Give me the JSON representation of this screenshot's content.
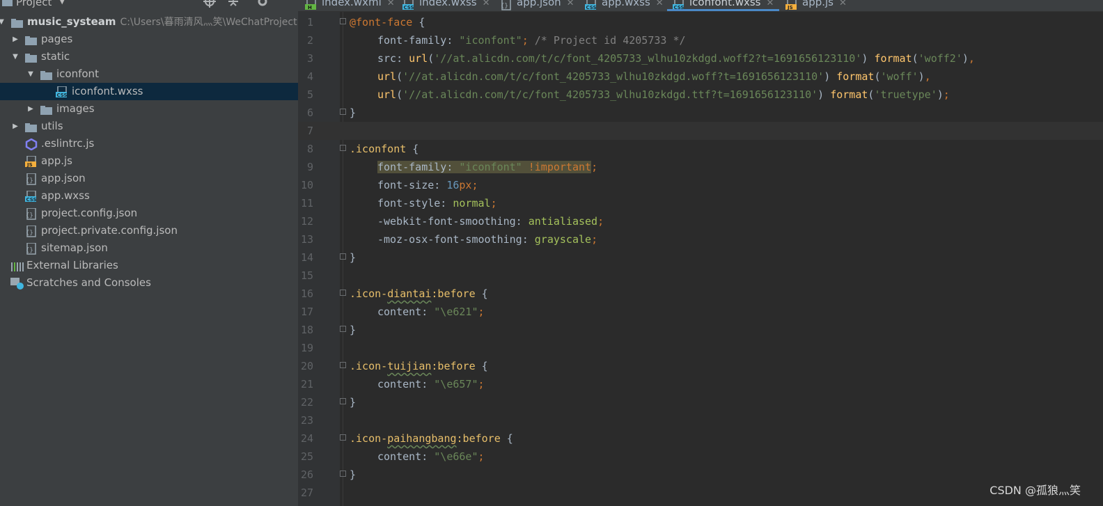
{
  "project_panel": {
    "title": "Project",
    "tree": [
      {
        "depth": 0,
        "arrow": "down",
        "icon": "folder",
        "label": "music_systeam",
        "path": "C:\\Users\\暮雨清风灬笑\\WeChatProject",
        "bold": true
      },
      {
        "depth": 1,
        "arrow": "right",
        "icon": "folder",
        "label": "pages"
      },
      {
        "depth": 1,
        "arrow": "down",
        "icon": "folder",
        "label": "static"
      },
      {
        "depth": 2,
        "arrow": "down",
        "icon": "folder",
        "label": "iconfont"
      },
      {
        "depth": 3,
        "arrow": "none",
        "icon": "css-file",
        "label": "iconfont.wxss",
        "selected": true
      },
      {
        "depth": 2,
        "arrow": "right",
        "icon": "folder",
        "label": "images"
      },
      {
        "depth": 1,
        "arrow": "right",
        "icon": "folder",
        "label": "utils"
      },
      {
        "depth": 1,
        "arrow": "none",
        "icon": "eslint",
        "label": ".eslintrc.js"
      },
      {
        "depth": 1,
        "arrow": "none",
        "icon": "js-file",
        "label": "app.js"
      },
      {
        "depth": 1,
        "arrow": "none",
        "icon": "json-file",
        "label": "app.json"
      },
      {
        "depth": 1,
        "arrow": "none",
        "icon": "css-file",
        "label": "app.wxss"
      },
      {
        "depth": 1,
        "arrow": "none",
        "icon": "json-file",
        "label": "project.config.json"
      },
      {
        "depth": 1,
        "arrow": "none",
        "icon": "json-file",
        "label": "project.private.config.json"
      },
      {
        "depth": 1,
        "arrow": "none",
        "icon": "json-file",
        "label": "sitemap.json"
      },
      {
        "depth": 0,
        "arrow": "none",
        "icon": "library",
        "label": "External Libraries"
      },
      {
        "depth": 0,
        "arrow": "none",
        "icon": "scratches",
        "label": "Scratches and Consoles"
      }
    ]
  },
  "tabs": [
    {
      "label": "index.wxml",
      "icon": "html-file",
      "active": false
    },
    {
      "label": "index.wxss",
      "icon": "css-file",
      "active": false
    },
    {
      "label": "app.json",
      "icon": "json-file",
      "active": false
    },
    {
      "label": "app.wxss",
      "icon": "css-file",
      "active": false
    },
    {
      "label": "iconfont.wxss",
      "icon": "css-file",
      "active": true
    },
    {
      "label": "app.js",
      "icon": "js-file",
      "active": false
    }
  ],
  "code_lines": [
    {
      "n": "1",
      "fold": true,
      "indent": false,
      "tokens": [
        [
          "kw",
          "@font-face"
        ],
        [
          "brace",
          " {"
        ]
      ]
    },
    {
      "n": "2",
      "indent": true,
      "tokens": [
        [
          "prop",
          "font-family: "
        ],
        [
          "str",
          "\"iconfont\""
        ],
        [
          "punc",
          ";"
        ],
        [
          "cmt",
          " /* Project id 4205733 */"
        ]
      ]
    },
    {
      "n": "3",
      "indent": true,
      "tokens": [
        [
          "prop",
          "src: "
        ],
        [
          "fn",
          "url"
        ],
        [
          "brace",
          "("
        ],
        [
          "str",
          "'//at.alicdn.com/t/c/font_4205733_wlhu10zkdgd.woff2?t=1691656123110'"
        ],
        [
          "brace",
          ") "
        ],
        [
          "fn",
          "format"
        ],
        [
          "brace",
          "("
        ],
        [
          "str",
          "'woff2'"
        ],
        [
          "brace",
          ")"
        ],
        [
          "punc",
          ","
        ]
      ]
    },
    {
      "n": "4",
      "indent": true,
      "tokens": [
        [
          "fn",
          "url"
        ],
        [
          "brace",
          "("
        ],
        [
          "str",
          "'//at.alicdn.com/t/c/font_4205733_wlhu10zkdgd.woff?t=1691656123110'"
        ],
        [
          "brace",
          ") "
        ],
        [
          "fn",
          "format"
        ],
        [
          "brace",
          "("
        ],
        [
          "str",
          "'woff'"
        ],
        [
          "brace",
          ")"
        ],
        [
          "punc",
          ","
        ]
      ]
    },
    {
      "n": "5",
      "indent": true,
      "tokens": [
        [
          "fn",
          "url"
        ],
        [
          "brace",
          "("
        ],
        [
          "str",
          "'//at.alicdn.com/t/c/font_4205733_wlhu10zkdgd.ttf?t=1691656123110'"
        ],
        [
          "brace",
          ") "
        ],
        [
          "fn",
          "format"
        ],
        [
          "brace",
          "("
        ],
        [
          "str",
          "'truetype'"
        ],
        [
          "brace",
          ")"
        ],
        [
          "punc",
          ";"
        ]
      ]
    },
    {
      "n": "6",
      "fold": true,
      "indent": false,
      "tokens": [
        [
          "brace",
          "}"
        ]
      ]
    },
    {
      "n": "7",
      "indent": false,
      "current": true,
      "tokens": []
    },
    {
      "n": "8",
      "fold": true,
      "indent": false,
      "tokens": [
        [
          "sel",
          ".iconfont"
        ],
        [
          "brace",
          " {"
        ]
      ]
    },
    {
      "n": "9",
      "indent": true,
      "tokens": [
        [
          "prop hl",
          "font-family: "
        ],
        [
          "str hl",
          "\"iconfont\" "
        ],
        [
          "kw hl",
          "!important"
        ],
        [
          "punc",
          ";"
        ]
      ]
    },
    {
      "n": "10",
      "indent": true,
      "tokens": [
        [
          "prop",
          "font-size: "
        ],
        [
          "num",
          "16"
        ],
        [
          "kw",
          "px"
        ],
        [
          "punc",
          ";"
        ]
      ]
    },
    {
      "n": "11",
      "indent": true,
      "tokens": [
        [
          "prop",
          "font-style: "
        ],
        [
          "val",
          "normal"
        ],
        [
          "punc",
          ";"
        ]
      ]
    },
    {
      "n": "12",
      "indent": true,
      "tokens": [
        [
          "prop",
          "-webkit-font-smoothing: "
        ],
        [
          "val",
          "antialiased"
        ],
        [
          "punc",
          ";"
        ]
      ]
    },
    {
      "n": "13",
      "indent": true,
      "tokens": [
        [
          "prop",
          "-moz-osx-font-smoothing: "
        ],
        [
          "val",
          "grayscale"
        ],
        [
          "punc",
          ";"
        ]
      ]
    },
    {
      "n": "14",
      "fold": true,
      "indent": false,
      "tokens": [
        [
          "brace",
          "}"
        ]
      ]
    },
    {
      "n": "15",
      "indent": false,
      "tokens": []
    },
    {
      "n": "16",
      "fold": true,
      "indent": false,
      "tokens": [
        [
          "sel",
          ".icon-"
        ],
        [
          "sel wavy",
          "diantai"
        ],
        [
          "sel",
          ":before"
        ],
        [
          "brace",
          " {"
        ]
      ]
    },
    {
      "n": "17",
      "indent": true,
      "tokens": [
        [
          "prop",
          "content: "
        ],
        [
          "str",
          "\"\\e621\""
        ],
        [
          "punc",
          ";"
        ]
      ]
    },
    {
      "n": "18",
      "fold": true,
      "indent": false,
      "tokens": [
        [
          "brace",
          "}"
        ]
      ]
    },
    {
      "n": "19",
      "indent": false,
      "tokens": []
    },
    {
      "n": "20",
      "fold": true,
      "indent": false,
      "tokens": [
        [
          "sel",
          ".icon-"
        ],
        [
          "sel wavy",
          "tuijian"
        ],
        [
          "sel",
          ":before"
        ],
        [
          "brace",
          " {"
        ]
      ]
    },
    {
      "n": "21",
      "indent": true,
      "tokens": [
        [
          "prop",
          "content: "
        ],
        [
          "str",
          "\"\\e657\""
        ],
        [
          "punc",
          ";"
        ]
      ]
    },
    {
      "n": "22",
      "fold": true,
      "indent": false,
      "tokens": [
        [
          "brace",
          "}"
        ]
      ]
    },
    {
      "n": "23",
      "indent": false,
      "tokens": []
    },
    {
      "n": "24",
      "fold": true,
      "indent": false,
      "tokens": [
        [
          "sel",
          ".icon-"
        ],
        [
          "sel wavy",
          "paihangbang"
        ],
        [
          "sel",
          ":before"
        ],
        [
          "brace",
          " {"
        ]
      ]
    },
    {
      "n": "25",
      "indent": true,
      "tokens": [
        [
          "prop",
          "content: "
        ],
        [
          "str",
          "\"\\e66e\""
        ],
        [
          "punc",
          ";"
        ]
      ]
    },
    {
      "n": "26",
      "fold": true,
      "indent": false,
      "tokens": [
        [
          "brace",
          "}"
        ]
      ]
    },
    {
      "n": "27",
      "indent": false,
      "tokens": []
    }
  ],
  "watermark": "CSDN @孤狼灬笑",
  "colors": {
    "panel_bg": "#3c3f41",
    "editor_bg": "#2b2b2b",
    "selection": "#0d293e",
    "active_tab_underline": "#4a88c7"
  }
}
